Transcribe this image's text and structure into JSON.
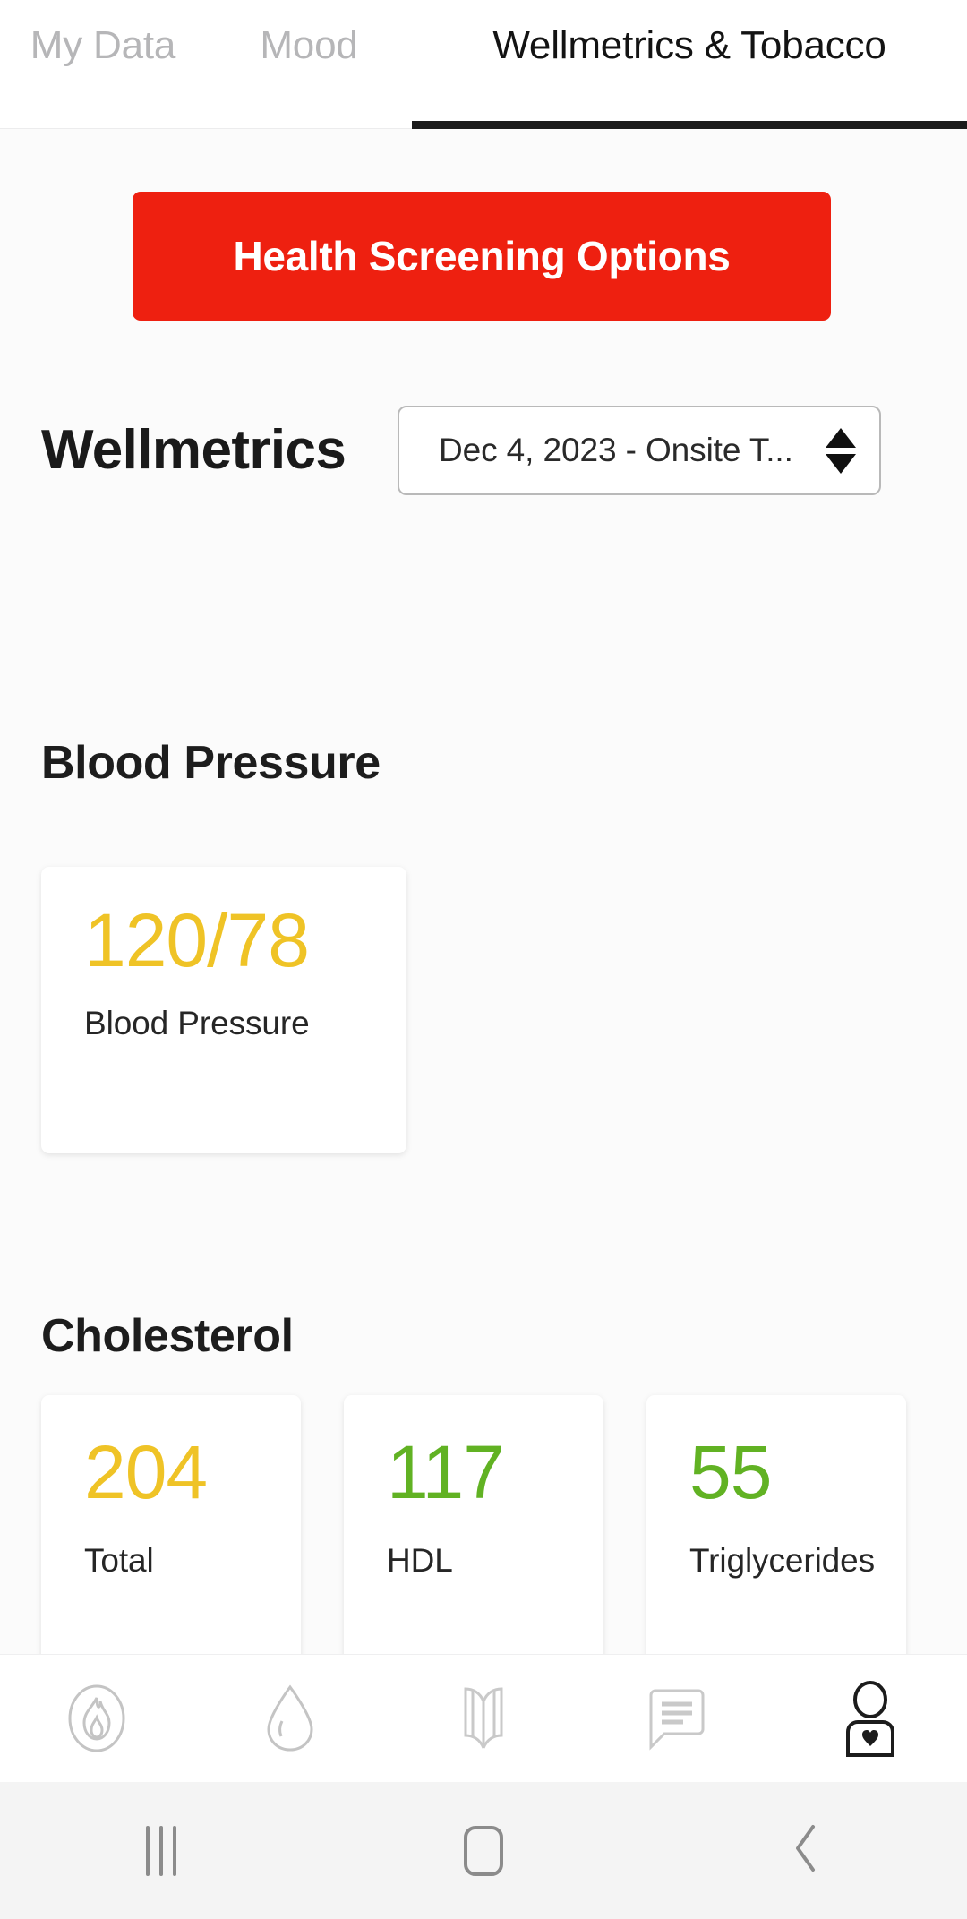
{
  "tabs": [
    {
      "label": "My Data",
      "active": false
    },
    {
      "label": "Mood",
      "active": false
    },
    {
      "label": "Wellmetrics & Tobacco",
      "active": true
    }
  ],
  "cta": {
    "label": "Health Screening Options",
    "color": "#ee2010"
  },
  "header": {
    "title": "Wellmetrics",
    "period_value": "Dec 4, 2023 - Onsite T...",
    "spinner_up_icon": "triangle-up-icon",
    "spinner_down_icon": "triangle-down-icon"
  },
  "sections": {
    "blood_pressure": {
      "heading": "Blood Pressure",
      "cards": [
        {
          "value": "120/78",
          "label": "Blood Pressure",
          "color": "#efc326"
        }
      ]
    },
    "cholesterol": {
      "heading": "Cholesterol",
      "cards": [
        {
          "value": "204",
          "label": "Total",
          "color": "#efc326"
        },
        {
          "value": "117",
          "label": "HDL",
          "color": "#61b223"
        },
        {
          "value": "55",
          "label": "Triglycerides",
          "color": "#61b223"
        }
      ]
    }
  },
  "bottom_nav": [
    {
      "icon": "flame-icon",
      "active": false
    },
    {
      "icon": "water-drop-icon",
      "active": false
    },
    {
      "icon": "open-book-icon",
      "active": false
    },
    {
      "icon": "chat-bubble-icon",
      "active": false
    },
    {
      "icon": "person-heart-icon",
      "active": true
    }
  ],
  "system_nav": [
    {
      "icon": "recents-icon"
    },
    {
      "icon": "home-icon"
    },
    {
      "icon": "back-icon"
    }
  ]
}
